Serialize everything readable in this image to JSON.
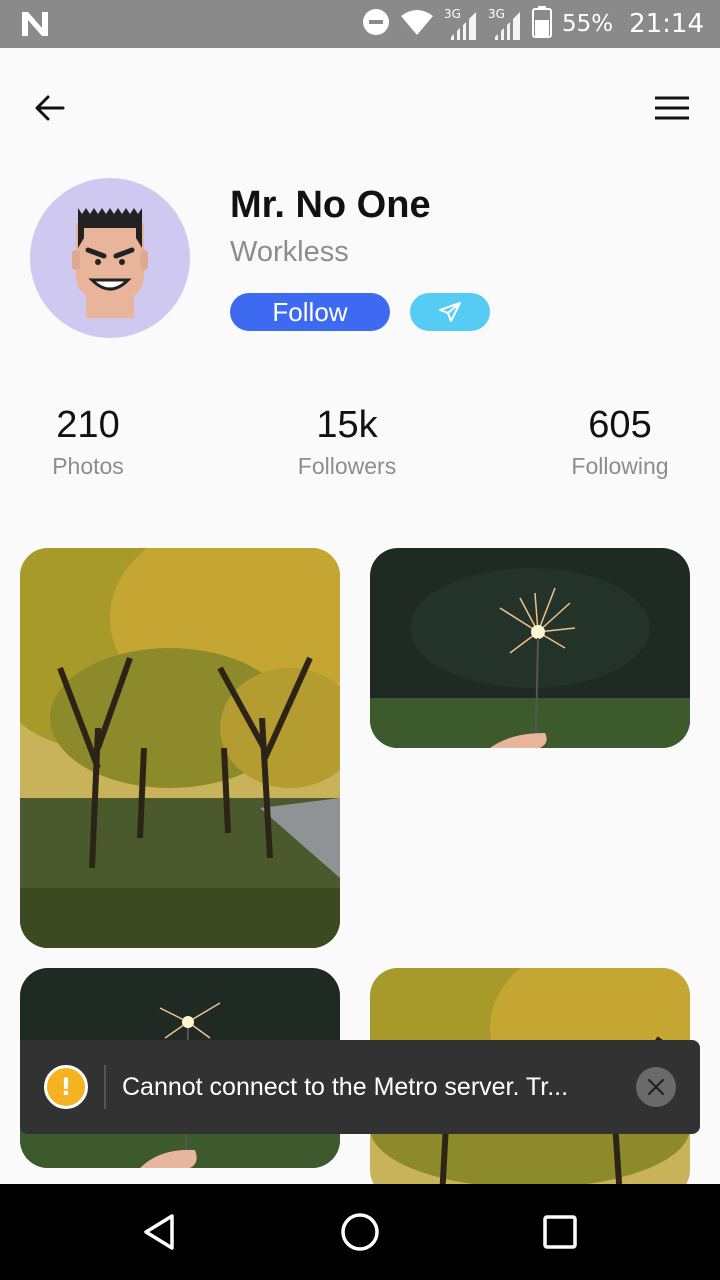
{
  "status_bar": {
    "network_1": "3G",
    "network_2": "3G",
    "battery": "55%",
    "time": "21:14"
  },
  "header": {
    "back_icon": "arrow-left-icon",
    "menu_icon": "hamburger-menu-icon"
  },
  "profile": {
    "name": "Mr. No One",
    "role": "Workless",
    "follow_label": "Follow",
    "send_icon": "paper-plane-icon"
  },
  "stats": [
    {
      "value": "210",
      "label": "Photos"
    },
    {
      "value": "15k",
      "label": "Followers"
    },
    {
      "value": "605",
      "label": "Following"
    }
  ],
  "photos": [
    {
      "subject": "autumn-trees"
    },
    {
      "subject": "sparkler"
    },
    {
      "subject": "sparkler"
    },
    {
      "subject": "autumn-trees"
    }
  ],
  "toast": {
    "message": "Cannot connect to the Metro server.  Tr...",
    "icon": "warning-icon",
    "close_icon": "close-icon",
    "icon_color": "#f5b321"
  },
  "colors": {
    "follow_button": "#3d6af0",
    "send_button": "#56ccf4",
    "avatar_bg": "#cfc9f2"
  },
  "nav": {
    "back_icon": "nav-back-icon",
    "home_icon": "nav-home-icon",
    "recents_icon": "nav-recents-icon"
  }
}
